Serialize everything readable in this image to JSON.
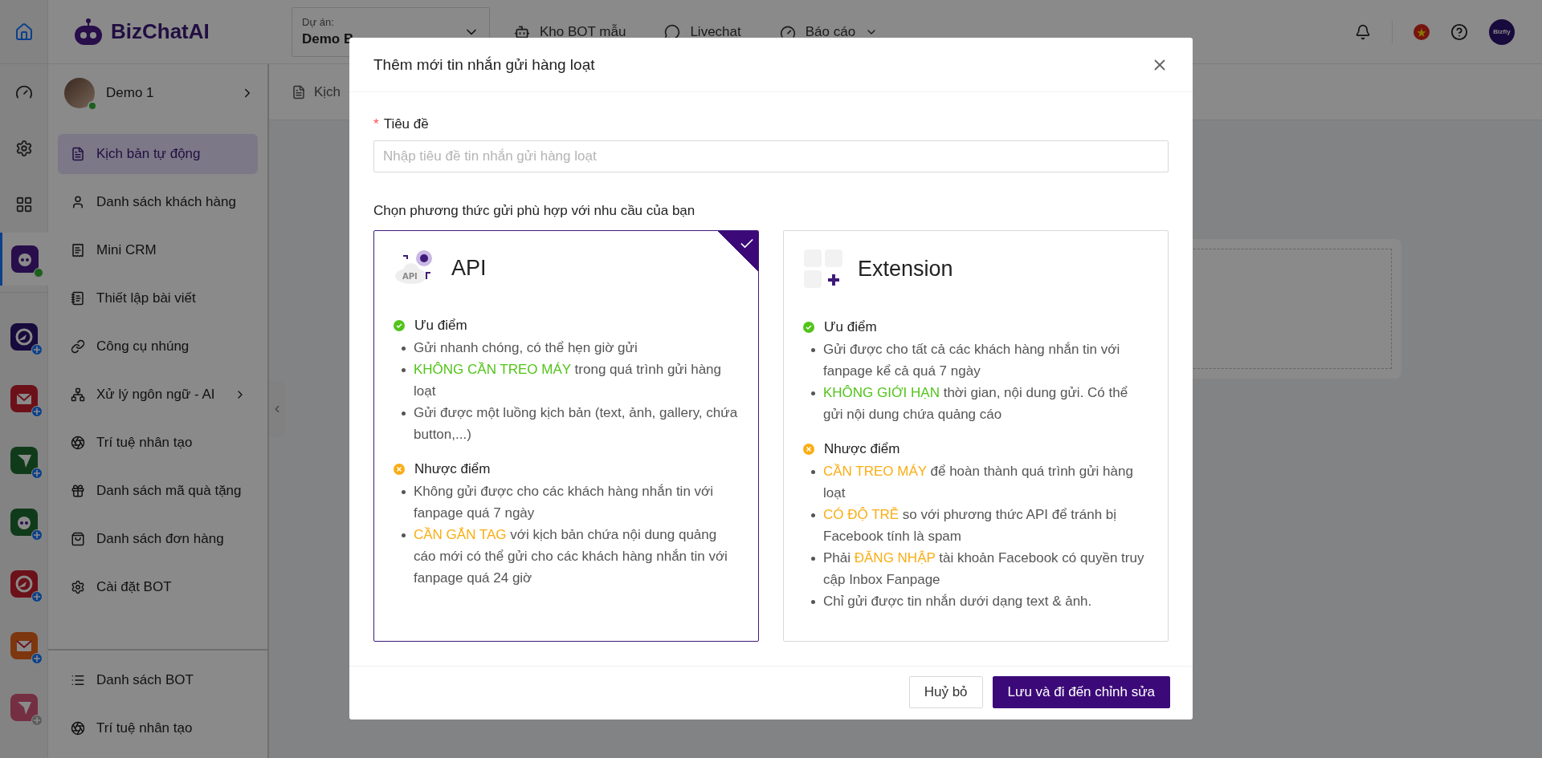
{
  "header": {
    "logo": "BizChatAI",
    "project": {
      "label": "Dự án:",
      "value": "Demo B"
    },
    "nav": [
      {
        "label": "Kho BOT mẫu",
        "dropdown": false
      },
      {
        "label": "Livechat",
        "dropdown": false
      },
      {
        "label": "Báo cáo",
        "dropdown": true
      }
    ],
    "avatar": "Bizfly"
  },
  "rail": {
    "apps": [
      {
        "kind": "bot",
        "selected": true,
        "online": true
      },
      {
        "kind": "app",
        "selected": false,
        "disabled": false
      },
      {
        "kind": "app",
        "selected": false,
        "disabled": false
      },
      {
        "kind": "app",
        "selected": false,
        "disabled": false
      },
      {
        "kind": "app",
        "selected": false,
        "disabled": false
      },
      {
        "kind": "app",
        "selected": false,
        "disabled": false
      },
      {
        "kind": "app",
        "selected": false,
        "disabled": false
      },
      {
        "kind": "app",
        "selected": false,
        "disabled": true
      }
    ]
  },
  "sidebar": {
    "profile": {
      "name": "Demo 1",
      "online": true
    },
    "items": [
      {
        "label": "Kịch bản tự động",
        "selected": true,
        "expandable": false
      },
      {
        "label": "Danh sách khách hàng",
        "selected": false,
        "expandable": false
      },
      {
        "label": "Mini CRM",
        "selected": false,
        "expandable": false
      },
      {
        "label": "Thiết lập bài viết",
        "selected": false,
        "expandable": false
      },
      {
        "label": "Công cụ nhúng",
        "selected": false,
        "expandable": false
      },
      {
        "label": "Xử lý ngôn ngữ - AI",
        "selected": false,
        "expandable": true
      },
      {
        "label": "Trí tuệ nhân tạo",
        "selected": false,
        "expandable": false
      },
      {
        "label": "Danh sách mã quà tặng",
        "selected": false,
        "expandable": false
      },
      {
        "label": "Danh sách đơn hàng",
        "selected": false,
        "expandable": false
      },
      {
        "label": "Cài đặt BOT",
        "selected": false,
        "expandable": false
      }
    ],
    "footer_items": [
      {
        "label": "Danh sách BOT",
        "selected": false
      },
      {
        "label": "Trí tuệ nhân tạo",
        "selected": false
      }
    ]
  },
  "content": {
    "tab": "Kịch"
  },
  "modal": {
    "title": "Thêm mới tin nhắn gửi hàng loạt",
    "field": {
      "label": "Tiêu đề",
      "required_mark": "*",
      "placeholder": "Nhập tiêu đề tin nhắn gửi hàng loạt"
    },
    "prompt": "Chọn phương thức gửi phù hợp với nhu cầu của bạn",
    "options": [
      {
        "kind": "api",
        "title": "API",
        "icon_label": "API",
        "selected": true,
        "sections": [
          {
            "kind": "pros",
            "heading": "Ưu điểm",
            "bullets": [
              [
                {
                  "kind": "plain",
                  "text": "Gửi nhanh chóng, có thể hẹn giờ gửi"
                }
              ],
              [
                {
                  "kind": "positive",
                  "text": "KHÔNG CẦN TREO MÁY"
                },
                {
                  "kind": "plain",
                  "text": " trong quá trình gửi hàng loạt"
                }
              ],
              [
                {
                  "kind": "plain",
                  "text": "Gửi được một luồng kịch bản (text, ảnh, gallery, chứa button,...)"
                }
              ]
            ]
          },
          {
            "kind": "cons",
            "heading": "Nhược điểm",
            "bullets": [
              [
                {
                  "kind": "plain",
                  "text": "Không gửi được cho các khách hàng nhắn tin với fanpage quá 7 ngày"
                }
              ],
              [
                {
                  "kind": "warning",
                  "text": "CẦN GẮN TAG"
                },
                {
                  "kind": "plain",
                  "text": " với kịch bản chứa nội dung quảng cáo mới có thể gửi cho các khách hàng nhắn tin với fanpage quá 24 giờ"
                }
              ]
            ]
          }
        ]
      },
      {
        "kind": "extension",
        "title": "Extension",
        "selected": false,
        "sections": [
          {
            "kind": "pros",
            "heading": "Ưu điểm",
            "bullets": [
              [
                {
                  "kind": "plain",
                  "text": "Gửi được cho tất cả các khách hàng nhắn tin với fanpage kể cả quá 7 ngày"
                }
              ],
              [
                {
                  "kind": "positive",
                  "text": "KHÔNG GIỚI HẠN"
                },
                {
                  "kind": "plain",
                  "text": " thời gian, nội dung gửi. Có thể gửi nội dung chứa quảng cáo"
                }
              ]
            ]
          },
          {
            "kind": "cons",
            "heading": "Nhược điểm",
            "bullets": [
              [
                {
                  "kind": "warning",
                  "text": "CẦN TREO MÁY"
                },
                {
                  "kind": "plain",
                  "text": " để hoàn thành quá trình gửi hàng loạt"
                }
              ],
              [
                {
                  "kind": "warning",
                  "text": "CÓ ĐỘ TRỄ"
                },
                {
                  "kind": "plain",
                  "text": " so với phương thức API để tránh bị Facebook tính là spam"
                }
              ],
              [
                {
                  "kind": "plain",
                  "text": "Phải "
                },
                {
                  "kind": "warning",
                  "text": "ĐĂNG NHẬP"
                },
                {
                  "kind": "plain",
                  "text": " tài khoản Facebook có quyền truy cập Inbox Fanpage"
                }
              ],
              [
                {
                  "kind": "plain",
                  "text": "Chỉ gửi được tin nhắn dưới dạng text & ảnh."
                }
              ]
            ]
          }
        ]
      }
    ],
    "buttons": [
      {
        "label": "Huỷ bỏ",
        "kind": "secondary"
      },
      {
        "label": "Lưu và đi đến chỉnh sửa",
        "kind": "primary"
      }
    ]
  }
}
